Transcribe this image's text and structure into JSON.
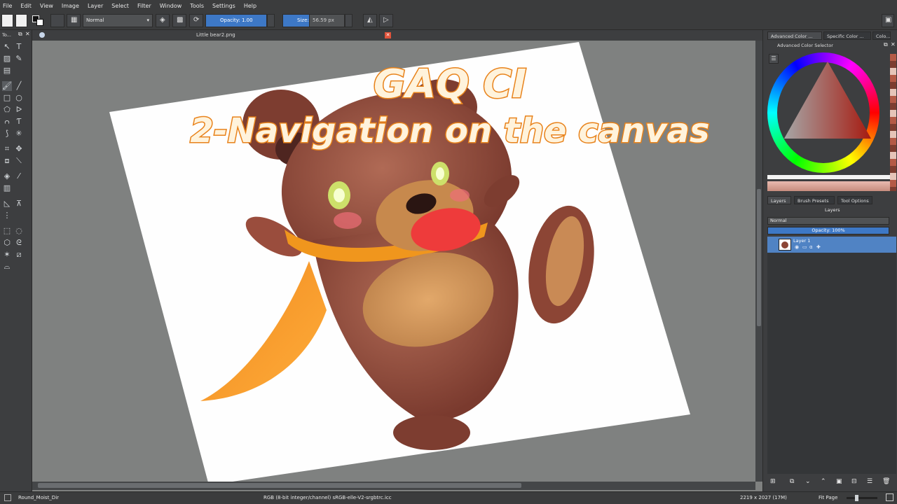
{
  "menu": [
    "File",
    "Edit",
    "View",
    "Image",
    "Layer",
    "Select",
    "Filter",
    "Window",
    "Tools",
    "Settings",
    "Help"
  ],
  "toolbar": {
    "blend_mode": "Normal",
    "opacity_label": "Opacity:  1.00",
    "size_label": "Size:",
    "size_value": "56.59 px"
  },
  "left_dock": {
    "title": "To..."
  },
  "document": {
    "tab_title": "Little bear2.png",
    "overlay_title_line1": "GAQ CI",
    "overlay_title_line2": "2-Navigation on the canvas"
  },
  "right_dock": {
    "color_tabs": [
      "Advanced Color ...",
      "Specific Color ...",
      "Colo..."
    ],
    "color_panel_title": "Advanced Color Selector",
    "layer_tabs": [
      "Layers",
      "Brush Presets",
      "Tool Options"
    ],
    "layers_title": "Layers",
    "layer_blend_mode": "Normal",
    "layer_opacity": "Opacity:  100%",
    "layers": [
      {
        "name": "Layer 1"
      }
    ]
  },
  "status": {
    "brush_name": "Round_Moist_Dir",
    "color_info": "RGB (8-bit integer/channel)  sRGB-elle-V2-srgbtrc.icc",
    "dimensions": "2219 x 2027 (17M)",
    "zoom_mode": "Fit Page"
  },
  "colors": {
    "accent": "#3d78c6",
    "title_fill": "#fff3dc",
    "title_stroke": "#e8821a"
  }
}
